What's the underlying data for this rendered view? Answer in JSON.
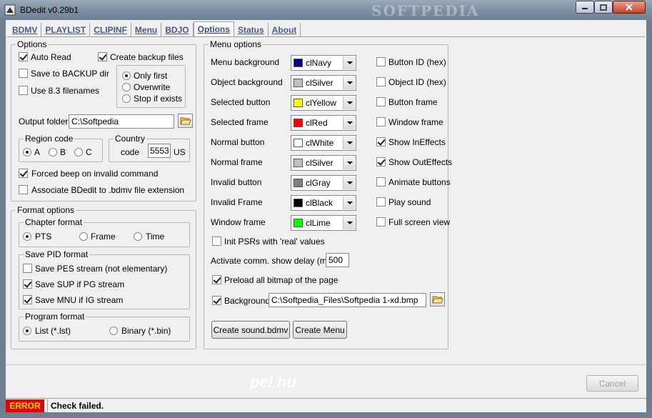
{
  "window": {
    "title": "BDedit v0.29b1",
    "watermark": "SOFTPEDIA"
  },
  "tabs": [
    {
      "label": "BDMV",
      "active": false
    },
    {
      "label": "PLAYLIST",
      "active": false
    },
    {
      "label": "CLIPINF",
      "active": false
    },
    {
      "label": "Menu",
      "active": false
    },
    {
      "label": "BDJO",
      "active": false
    },
    {
      "label": "Options",
      "active": true
    },
    {
      "label": "Status",
      "active": false
    },
    {
      "label": "About",
      "active": false
    }
  ],
  "options": {
    "title": "Options",
    "auto_read": {
      "label": "Auto Read",
      "checked": true
    },
    "create_backup": {
      "label": "Create backup files",
      "checked": true
    },
    "save_to_backup": {
      "label": "Save to BACKUP dir",
      "checked": false
    },
    "use_83": {
      "label": "Use 8.3 filenames",
      "checked": false
    },
    "backup_mode": [
      {
        "label": "Only first",
        "selected": true
      },
      {
        "label": "Overwrite",
        "selected": false
      },
      {
        "label": "Stop if exists",
        "selected": false
      }
    ],
    "output_folder_label": "Output folder",
    "output_folder_value": "C:\\Softpedia",
    "region_title": "Region code",
    "regions": [
      {
        "label": "A",
        "selected": true
      },
      {
        "label": "B",
        "selected": false
      },
      {
        "label": "C",
        "selected": false
      }
    ],
    "country_title": "Country",
    "country_code_label": "code",
    "country_code_value": "5553",
    "country_code_unit": "US",
    "forced_beep": {
      "label": "Forced beep on invalid command",
      "checked": true
    },
    "associate": {
      "label": "Associate BDedit to .bdmv file extension",
      "checked": false
    }
  },
  "format_options": {
    "title": "Format options",
    "chapter_title": "Chapter format",
    "chapter_formats": [
      {
        "label": "PTS",
        "selected": true
      },
      {
        "label": "Frame",
        "selected": false
      },
      {
        "label": "Time",
        "selected": false
      }
    ],
    "pid_title": "Save PID format",
    "pid_items": [
      {
        "label": "Save PES stream (not elementary)",
        "checked": false
      },
      {
        "label": "Save SUP if PG stream",
        "checked": true
      },
      {
        "label": "Save MNU if IG stream",
        "checked": true
      }
    ],
    "program_title": "Program format",
    "program_formats": [
      {
        "label": "List (*.lst)",
        "selected": true
      },
      {
        "label": "Binary (*.bin)",
        "selected": false
      }
    ]
  },
  "menu_options": {
    "title": "Menu options",
    "colors": [
      {
        "label": "Menu background",
        "value": "clNavy",
        "swatch": "#000080"
      },
      {
        "label": "Object background",
        "value": "clSilver",
        "swatch": "#c0c0c0"
      },
      {
        "label": "Selected button",
        "value": "clYellow",
        "swatch": "#ffff00"
      },
      {
        "label": "Selected frame",
        "value": "clRed",
        "swatch": "#ff0000"
      },
      {
        "label": "Normal button",
        "value": "clWhite",
        "swatch": "#ffffff"
      },
      {
        "label": "Normal frame",
        "value": "clSilver",
        "swatch": "#c0c0c0"
      },
      {
        "label": "Invalid button",
        "value": "clGray",
        "swatch": "#808080"
      },
      {
        "label": "Invalid Frame",
        "value": "clBlack",
        "swatch": "#000000"
      },
      {
        "label": "Window frame",
        "value": "clLime",
        "swatch": "#00ff00"
      }
    ],
    "flags": [
      {
        "label": "Button ID (hex)",
        "checked": false
      },
      {
        "label": "Object ID (hex)",
        "checked": false
      },
      {
        "label": "Button frame",
        "checked": false
      },
      {
        "label": "Window frame",
        "checked": false
      },
      {
        "label": "Show InEffects",
        "checked": true
      },
      {
        "label": "Show OutEffects",
        "checked": true
      },
      {
        "label": "Animate buttons",
        "checked": false
      },
      {
        "label": "Play sound",
        "checked": false
      },
      {
        "label": "Full screen view",
        "checked": false
      }
    ],
    "init_psrs": {
      "label": "Init PSRs with 'real' values",
      "checked": false
    },
    "activate_delay_label": "Activate comm. show delay (ms)",
    "activate_delay_value": "500",
    "preload": {
      "label": "Preload all bitmap of the page",
      "checked": true
    },
    "background": {
      "label": "Background",
      "checked": true,
      "value": "C:\\Softpedia_Files\\Softpedia 1-xd.bmp"
    },
    "create_sound_label": "Create sound.bdmv",
    "create_menu_label": "Create Menu"
  },
  "footer": {
    "cancel_label": "Cancel",
    "site_watermark": "pel.hu"
  },
  "status": {
    "error_label": "ERROR",
    "message": "Check failed."
  }
}
